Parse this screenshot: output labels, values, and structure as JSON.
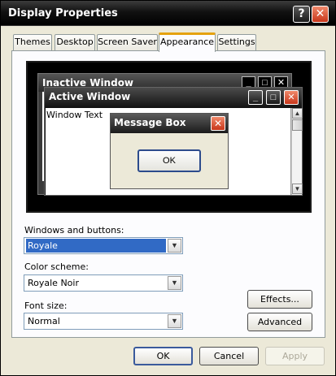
{
  "window": {
    "title": "Display Properties"
  },
  "titlebar": {
    "help": "?",
    "close": "✕"
  },
  "tabs": [
    {
      "label": "Themes"
    },
    {
      "label": "Desktop"
    },
    {
      "label": "Screen Saver"
    },
    {
      "label": "Appearance"
    },
    {
      "label": "Settings"
    }
  ],
  "active_tab": "Appearance",
  "preview": {
    "inactive_title": "Inactive Window",
    "active_title": "Active Window",
    "window_text": "Window Text",
    "message_box": {
      "title": "Message Box",
      "ok": "OK"
    }
  },
  "controls": {
    "windows_buttons_label": "Windows and buttons:",
    "windows_buttons_value": "Royale",
    "color_scheme_label": "Color scheme:",
    "color_scheme_value": "Royale Noir",
    "font_size_label": "Font size:",
    "font_size_value": "Normal",
    "effects_label": "Effects...",
    "advanced_label": "Advanced"
  },
  "footer": {
    "ok": "OK",
    "cancel": "Cancel",
    "apply": "Apply"
  },
  "icons": {
    "minimize": "_",
    "maximize": "□",
    "close": "✕",
    "dropdown": "▼",
    "scroll_up": "▲",
    "scroll_down": "▼"
  }
}
